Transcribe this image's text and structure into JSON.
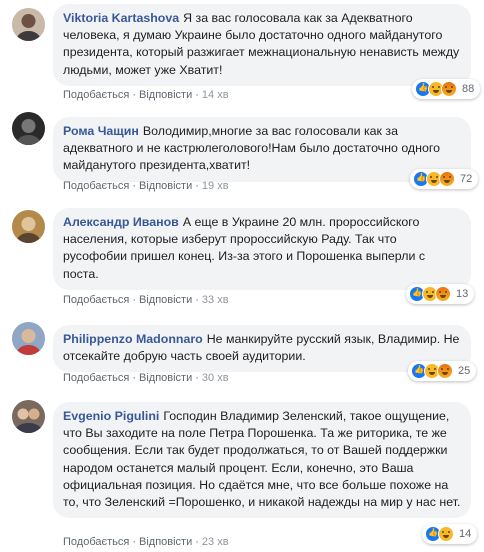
{
  "actions": {
    "like": "Подобається",
    "reply": "Відповісти",
    "separator": "·"
  },
  "comments": [
    {
      "author": "Viktoria Kartashova",
      "text": "Я за вас голосовала как за Адекватного человека, я думаю Украине было достаточно одного майданутого президента, который разжигает межнациональную ненависть между людьми, может уже Хватит!",
      "time": "14 хв",
      "reaction_count": "88",
      "reactions": [
        "like-icon",
        "haha-icon",
        "angry-icon"
      ]
    },
    {
      "author": "Рома Чащин",
      "text": "Володимир,многие за вас голосовали как за адекватного и не кастрюлеголового!Нам было достаточно одного майданутого президента,хватит!",
      "time": "19 хв",
      "reaction_count": "72",
      "reactions": [
        "like-icon",
        "haha-icon",
        "angry-icon"
      ]
    },
    {
      "author": "Александр Иванов",
      "text": "А еще в Украине 20 млн. пророссийского населения, которые изберут пророссийскую Раду. Так что русофобии пришел конец. Из-за этого и Порошенка выперли с поста.",
      "time": "33 хв",
      "reaction_count": "13",
      "reactions": [
        "like-icon",
        "haha-icon",
        "angry-icon"
      ]
    },
    {
      "author": "Philippenzo Madonnaro",
      "text": "Не манкируйте русский язык, Владимир. Не отсекайте добрую часть своей аудитории.",
      "time": "30 хв",
      "reaction_count": "25",
      "reactions": [
        "like-icon",
        "haha-icon",
        "angry-icon"
      ]
    },
    {
      "author": "Evgenio Pigulini",
      "text": "Господин Владимир Зеленский, такое ощущение, что Вы заходите на поле Петра Порошенка. Та же риторика, те же сообщения. Если так будет продолжаться, то от Вашей поддержки народом останется малый процент. Если, конечно, это Ваша официальная позиция. Но сдаётся мне, что все больше похоже на то, что Зеленский =Порошенко, и никакой надежды на мир у нас нет.",
      "time": "23 хв",
      "reaction_count": "14",
      "reactions": [
        "like-icon",
        "haha-icon"
      ]
    }
  ]
}
